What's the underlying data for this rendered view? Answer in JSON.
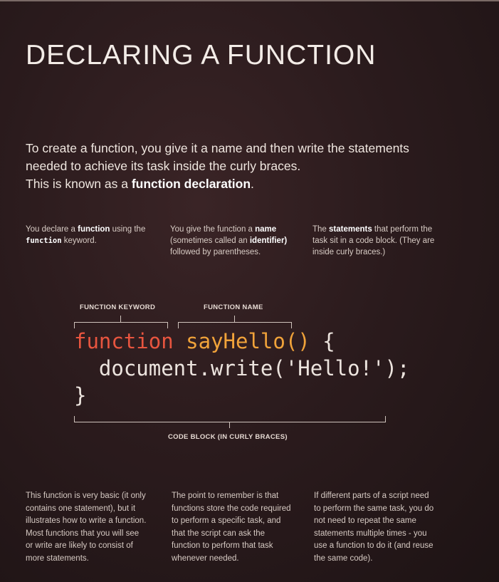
{
  "title": "DECLARING A FUNCTION",
  "intro": {
    "line1": "To create a function, you give it a name and then write the statements",
    "line2": "needed to achieve its task inside the curly braces.",
    "line3_prefix": "This is known as a ",
    "line3_bold": "function declaration",
    "line3_suffix": "."
  },
  "notes": {
    "col1": {
      "t1": "You declare a ",
      "b1": "function",
      "t2": " using the ",
      "code": "function",
      "t3": " keyword."
    },
    "col2": {
      "t1": "You give the function a ",
      "b1": "name",
      "t2": " (sometimes called an ",
      "b2": "identifier)",
      "t3": " followed by parentheses."
    },
    "col3": {
      "t0": "The ",
      "b1": "statements",
      "t1": " that perform the task sit in a code block. (They are inside curly braces.)"
    }
  },
  "labels": {
    "keyword": "FUNCTION KEYWORD",
    "name": "FUNCTION NAME",
    "block": "CODE BLOCK (IN CURLY BRACES)"
  },
  "code": {
    "keyword": "function",
    "name": "sayHello()",
    "open_brace": " {",
    "line2": "  document.write('Hello!');",
    "close_brace": "}"
  },
  "bottom": {
    "col1": "This function is very basic (it only contains one statement), but it illustrates how to write a function. Most functions that you will see or write are likely to consist of more statements.",
    "col2": "The point to remember is that functions store the code required to perform a specific task, and that the script can ask the function to perform that task whenever needed.",
    "col3": "If different parts of a script need to perform the same task, you do not need to repeat the same statements multiple times - you use a function to do it (and reuse the same code)."
  }
}
